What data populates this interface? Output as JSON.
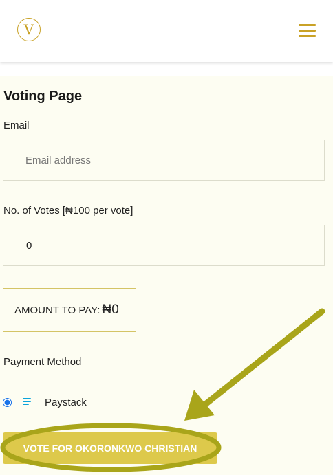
{
  "header": {
    "logo_letter": "V",
    "menu_icon": "hamburger-menu-icon"
  },
  "form": {
    "title": "Voting Page",
    "email_label": "Email",
    "email_placeholder": "Email address",
    "votes_label": "No. of Votes [₦100 per vote]",
    "votes_value": "0",
    "amount_label": "AMOUNT TO PAY:",
    "amount_value": "₦0",
    "payment_label": "Payment Method",
    "payment_option": "Paystack",
    "payment_selected": true,
    "submit_label": "VOTE FOR OKORONKWO CHRISTIAN"
  },
  "colors": {
    "accent": "#c9a227",
    "button": "#ddc94b",
    "page_background": "#fdfdf2",
    "annotation": "#a9a51a",
    "paystack": "#0ba4db"
  }
}
